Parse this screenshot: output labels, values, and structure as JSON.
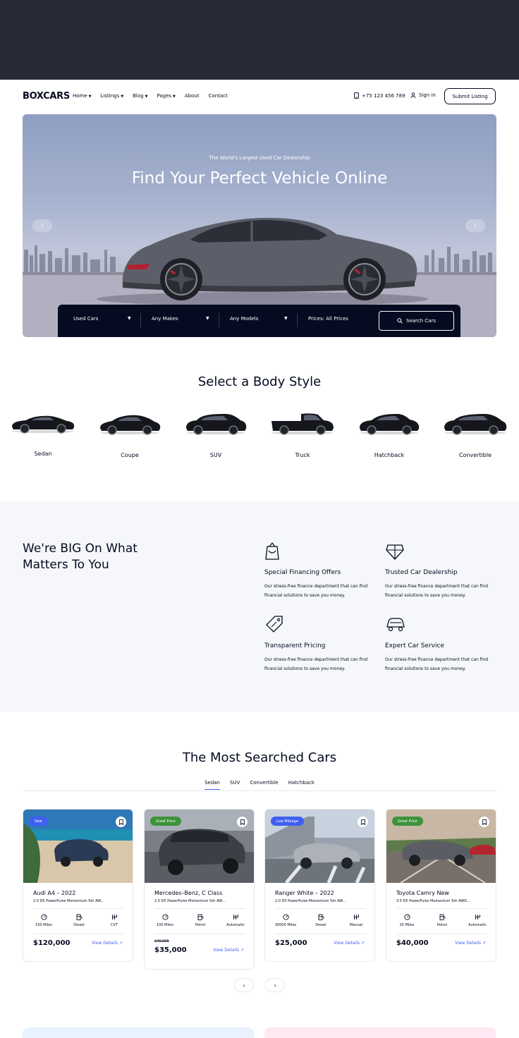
{
  "header": {
    "logo": "BOXCARS",
    "nav": [
      {
        "label": "Home",
        "dropdown": true
      },
      {
        "label": "Listings",
        "dropdown": true
      },
      {
        "label": "Blog",
        "dropdown": true
      },
      {
        "label": "Pages",
        "dropdown": true
      },
      {
        "label": "About",
        "dropdown": false
      },
      {
        "label": "Contact",
        "dropdown": false
      }
    ],
    "phone": "+75 123 456 789",
    "signin": "Sign in",
    "submit": "Submit Listing"
  },
  "hero": {
    "subtitle": "The World's Largest Used Car Dealership",
    "title": "Find Your Perfect Vehicle Online",
    "search": {
      "condition": "Used Cars",
      "makes": "Any Makes",
      "models": "Any Models",
      "prices": "Prices: All Prices",
      "button": "Search Cars"
    }
  },
  "body_styles": {
    "title": "Select a Body Style",
    "items": [
      "Sedan",
      "Coupe",
      "SUV",
      "Truck",
      "Hatchback",
      "Convertible"
    ]
  },
  "big": {
    "title": "We're BIG On What Matters To You",
    "features": [
      {
        "title": "Special Financing Offers",
        "desc": "Our stress-free finance department that can find financial solutions to save you money.",
        "icon": "financing-icon"
      },
      {
        "title": "Trusted Car Dealership",
        "desc": "Our stress-free finance department that can find financial solutions to save you money.",
        "icon": "diamond-icon"
      },
      {
        "title": "Transparent Pricing",
        "desc": "Our stress-free finance department that can find financial solutions to save you money.",
        "icon": "price-tag-icon"
      },
      {
        "title": "Expert Car Service",
        "desc": "Our stress-free finance department that can find financial solutions to save you money.",
        "icon": "car-service-icon"
      }
    ]
  },
  "most_searched": {
    "title": "The Most Searched Cars",
    "tabs": [
      "Sedan",
      "SUV",
      "Convertible",
      "Hatchback"
    ],
    "cars": [
      {
        "badge": "Sale",
        "badge_color": "#405ff2",
        "title": "Audi A4 – 2022",
        "sub": "2.0 D5 PowerPulse Momentum 5dr AW...",
        "miles": "150 Miles",
        "fuel": "Diesel",
        "trans": "CVT",
        "price": "$120,000",
        "old_price": "",
        "view": "View Details"
      },
      {
        "badge": "Great Price",
        "badge_color": "#3d923a",
        "title": "Mercedes–Benz, C Class",
        "sub": "2.0 D5 PowerPulse Momentum 5dr AW...",
        "miles": "100 Miles",
        "fuel": "Petrol",
        "trans": "Automatic",
        "price": "$35,000",
        "old_price": "$40,000",
        "view": "View Details"
      },
      {
        "badge": "Low Mileage",
        "badge_color": "#405ff2",
        "title": "Ranger White – 2022",
        "sub": "2.0 D5 PowerPulse Momentum 5dr AW...",
        "miles": "30000 Miles",
        "fuel": "Diesel",
        "trans": "Manual",
        "price": "$25,000",
        "old_price": "",
        "view": "View Details"
      },
      {
        "badge": "Great Price",
        "badge_color": "#3d923a",
        "title": "Toyota Camry New",
        "sub": "3.5 D5 PowerPulse Momentum 5dr AWD...",
        "miles": "20 Miles",
        "fuel": "Petrol",
        "trans": "Automatic",
        "price": "$40,000",
        "old_price": "",
        "view": "View Details"
      }
    ]
  },
  "colors": {
    "dark": "#050b20",
    "accent": "#405ff2",
    "green": "#3d923a",
    "topbar": "#272b36",
    "section_bg": "#f6f7fa"
  }
}
